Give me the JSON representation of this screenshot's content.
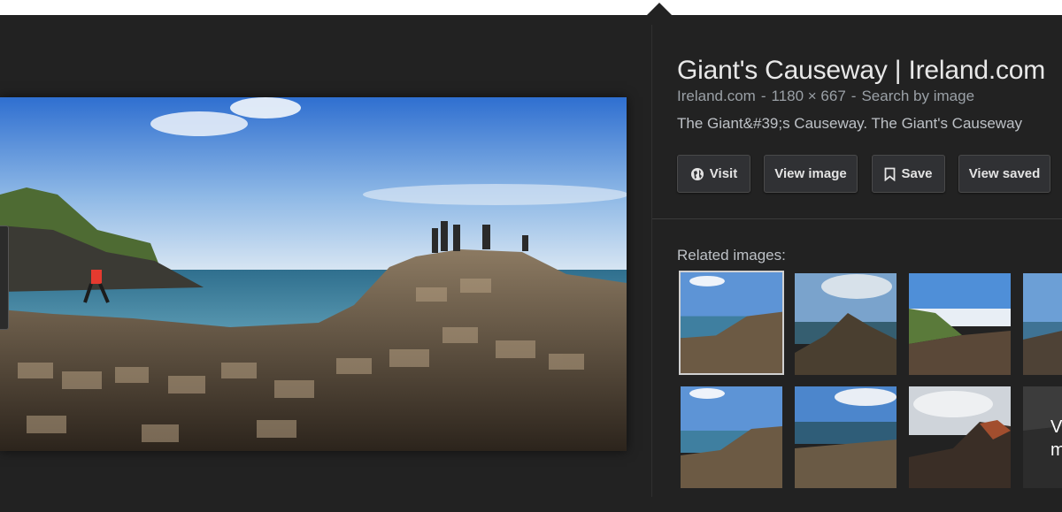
{
  "preview": {
    "title": "Giant's Causeway | Ireland.com",
    "source": "Ireland.com",
    "dimensions": "1180 × 667",
    "search_by_image": "Search by image",
    "description": "The Giant&#39;s Causeway. The Giant's Causeway"
  },
  "buttons": {
    "visit": "Visit",
    "view_image": "View image",
    "save": "Save",
    "view_saved": "View saved"
  },
  "related": {
    "label": "Related images:",
    "more_text": "V m"
  },
  "colors": {
    "panel_bg": "#222222",
    "button_bg": "#303134",
    "text_primary": "#e8e8e8",
    "text_secondary": "#9aa0a6"
  },
  "icons": {
    "visit": "globe-icon",
    "save": "bookmark-icon"
  }
}
